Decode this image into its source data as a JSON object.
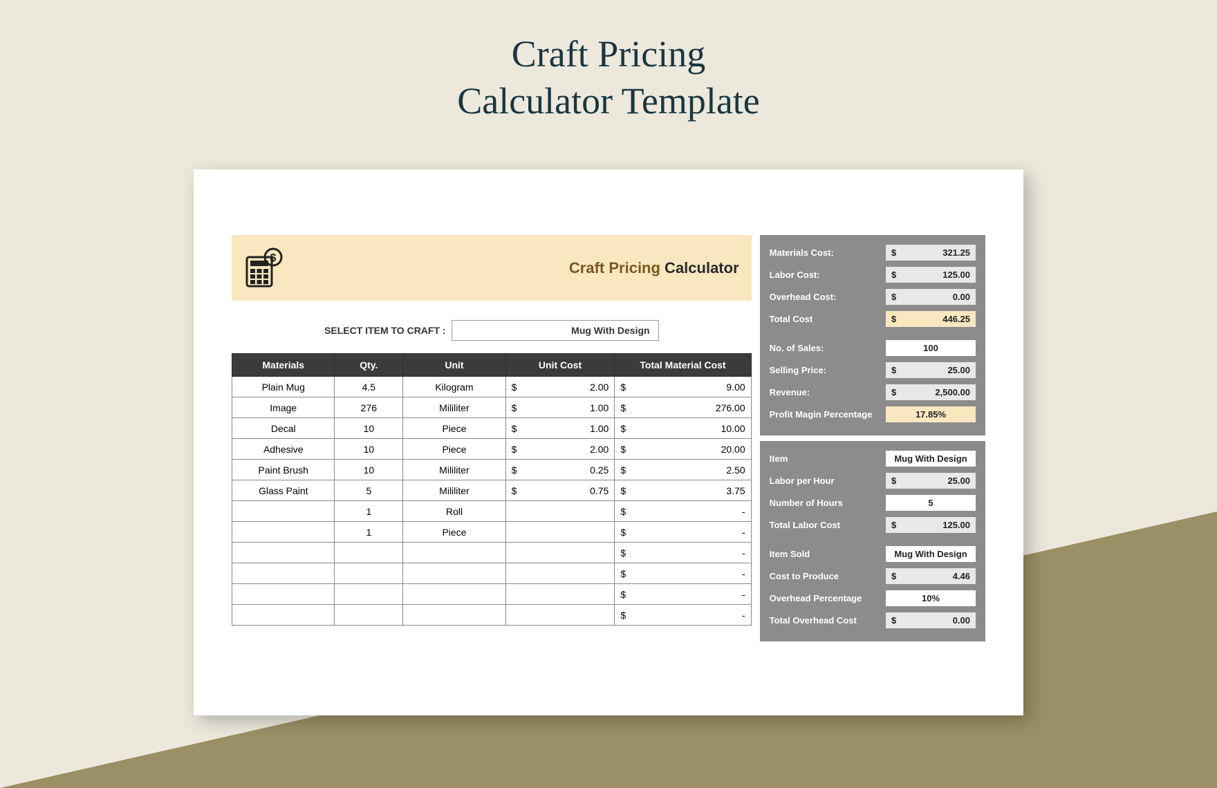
{
  "page_title_line1": "Craft Pricing",
  "page_title_line2": "Calculator Template",
  "header": {
    "brown": "Craft Pricing",
    "dark": " Calculator"
  },
  "select_label": "SELECT ITEM TO CRAFT    :",
  "select_value": "Mug With Design",
  "table_headers": [
    "Materials",
    "Qty.",
    "Unit",
    "Unit Cost",
    "Total Material Cost"
  ],
  "rows": [
    {
      "material": "Plain Mug",
      "qty": "4.5",
      "unit": "Kilogram",
      "unit_cost": "2.00",
      "total": "9.00"
    },
    {
      "material": "Image",
      "qty": "276",
      "unit": "Mililiter",
      "unit_cost": "1.00",
      "total": "276.00"
    },
    {
      "material": "Decal",
      "qty": "10",
      "unit": "Piece",
      "unit_cost": "1.00",
      "total": "10.00"
    },
    {
      "material": "Adhesive",
      "qty": "10",
      "unit": "Piece",
      "unit_cost": "2.00",
      "total": "20.00"
    },
    {
      "material": "Paint Brush",
      "qty": "10",
      "unit": "Mililiter",
      "unit_cost": "0.25",
      "total": "2.50"
    },
    {
      "material": "Glass Paint",
      "qty": "5",
      "unit": "Mililiter",
      "unit_cost": "0.75",
      "total": "3.75"
    },
    {
      "material": "",
      "qty": "1",
      "unit": "Roll",
      "unit_cost": "",
      "total": "-"
    },
    {
      "material": "",
      "qty": "1",
      "unit": "Piece",
      "unit_cost": "",
      "total": "-"
    },
    {
      "material": "",
      "qty": "",
      "unit": "",
      "unit_cost": "",
      "total": "-"
    },
    {
      "material": "",
      "qty": "",
      "unit": "",
      "unit_cost": "",
      "total": "-"
    },
    {
      "material": "",
      "qty": "",
      "unit": "",
      "unit_cost": "",
      "total": "-"
    },
    {
      "material": "",
      "qty": "",
      "unit": "",
      "unit_cost": "",
      "total": "-"
    }
  ],
  "summary1": {
    "materials_label": "Materials Cost:",
    "materials_val": "321.25",
    "labor_label": "Labor Cost:",
    "labor_val": "125.00",
    "overhead_label": "Overhead Cost:",
    "overhead_val": "0.00",
    "total_label": "Total Cost",
    "total_val": "446.25",
    "sales_label": "No. of Sales:",
    "sales_val": "100",
    "price_label": "Selling Price:",
    "price_val": "25.00",
    "revenue_label": "Revenue:",
    "revenue_val": "2,500.00",
    "profit_label": "Profit Magin Percentage",
    "profit_val": "17.85%"
  },
  "summary2": {
    "item_label": "Item",
    "item_val": "Mug With Design",
    "labor_hr_label": "Labor per Hour",
    "labor_hr_val": "25.00",
    "hours_label": "Number of Hours",
    "hours_val": "5",
    "total_labor_label": "Total Labor Cost",
    "total_labor_val": "125.00",
    "sold_label": "Item Sold",
    "sold_val": "Mug With Design",
    "cost_prod_label": "Cost to Produce",
    "cost_prod_val": "4.46",
    "overhead_pct_label": "Overhead Percentage",
    "overhead_pct_val": "10%",
    "total_overhead_label": "Total Overhead Cost",
    "total_overhead_val": "0.00"
  },
  "currency": "$"
}
